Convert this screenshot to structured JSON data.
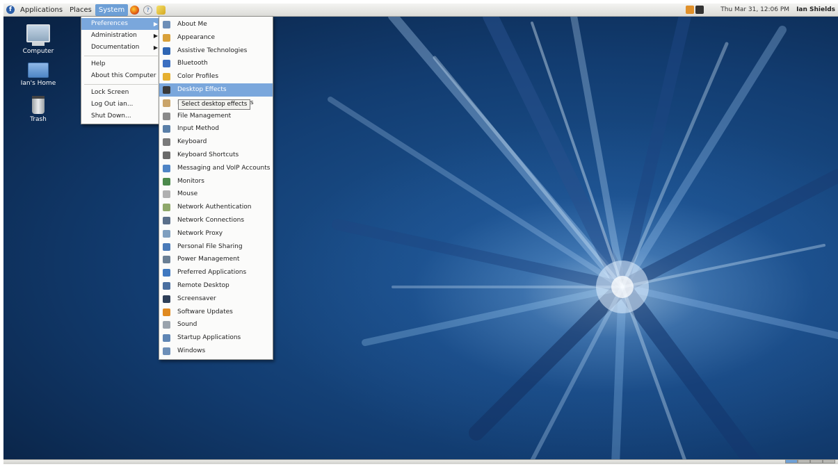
{
  "top_panel": {
    "menus": [
      "Applications",
      "Places",
      "System"
    ],
    "clock": "Thu Mar 31, 12:06 PM",
    "user": "Ian Shields"
  },
  "desktop_icons": [
    {
      "label": "Computer",
      "icon": "computer-icon"
    },
    {
      "label": "Ian's Home",
      "icon": "home-folder-icon"
    },
    {
      "label": "Trash",
      "icon": "trash-icon"
    }
  ],
  "system_menu": {
    "items": [
      "Preferences",
      "Administration",
      "Documentation",
      "Help",
      "About this Computer",
      "Lock Screen",
      "Log Out ian...",
      "Shut Down..."
    ]
  },
  "preferences_menu": {
    "items": [
      {
        "label": "About Me",
        "icon": "about-me-icon",
        "color": "#6d8fb8"
      },
      {
        "label": "Appearance",
        "icon": "appearance-icon",
        "color": "#d9a13a"
      },
      {
        "label": "Assistive Technologies",
        "icon": "assistive-icon",
        "color": "#2f66b3"
      },
      {
        "label": "Bluetooth",
        "icon": "bluetooth-icon",
        "color": "#3b6fc1"
      },
      {
        "label": "Color Profiles",
        "icon": "color-profiles-icon",
        "color": "#e6b030"
      },
      {
        "label": "Desktop Effects",
        "icon": "desktop-effects-icon",
        "color": "#3a3a3a"
      },
      {
        "label": "Encryption and Keyrings",
        "icon": "keyring-icon",
        "color": "#c9a46a"
      },
      {
        "label": "File Management",
        "icon": "file-management-icon",
        "color": "#8a8a8a"
      },
      {
        "label": "Input Method",
        "icon": "input-method-icon",
        "color": "#5a7fa8"
      },
      {
        "label": "Keyboard",
        "icon": "keyboard-icon",
        "color": "#7a7a7a"
      },
      {
        "label": "Keyboard Shortcuts",
        "icon": "keyboard-shortcuts-icon",
        "color": "#6a6a6a"
      },
      {
        "label": "Messaging and VoIP Accounts",
        "icon": "messaging-icon",
        "color": "#4f85c6"
      },
      {
        "label": "Monitors",
        "icon": "monitors-icon",
        "color": "#4c8a4c"
      },
      {
        "label": "Mouse",
        "icon": "mouse-icon",
        "color": "#b0b0b0"
      },
      {
        "label": "Network Authentication",
        "icon": "network-auth-icon",
        "color": "#8fa86a"
      },
      {
        "label": "Network Connections",
        "icon": "network-connections-icon",
        "color": "#5a6f8a"
      },
      {
        "label": "Network Proxy",
        "icon": "network-proxy-icon",
        "color": "#7f9fbf"
      },
      {
        "label": "Personal File Sharing",
        "icon": "file-sharing-icon",
        "color": "#4a7ab8"
      },
      {
        "label": "Power Management",
        "icon": "power-icon",
        "color": "#6a7f95"
      },
      {
        "label": "Preferred Applications",
        "icon": "preferred-apps-icon",
        "color": "#3f78c0"
      },
      {
        "label": "Remote Desktop",
        "icon": "remote-desktop-icon",
        "color": "#4a6fa0"
      },
      {
        "label": "Screensaver",
        "icon": "screensaver-icon",
        "color": "#2e3f58"
      },
      {
        "label": "Software Updates",
        "icon": "software-updates-icon",
        "color": "#e08a20"
      },
      {
        "label": "Sound",
        "icon": "sound-icon",
        "color": "#9aa3ad"
      },
      {
        "label": "Startup Applications",
        "icon": "startup-apps-icon",
        "color": "#5f86b5"
      },
      {
        "label": "Windows",
        "icon": "windows-icon",
        "color": "#6d8fb8"
      }
    ]
  },
  "tooltip": "Select desktop effects",
  "colors": {
    "menu_highlight": "#7aa7dc",
    "wallpaper": "#1f5a9a"
  }
}
